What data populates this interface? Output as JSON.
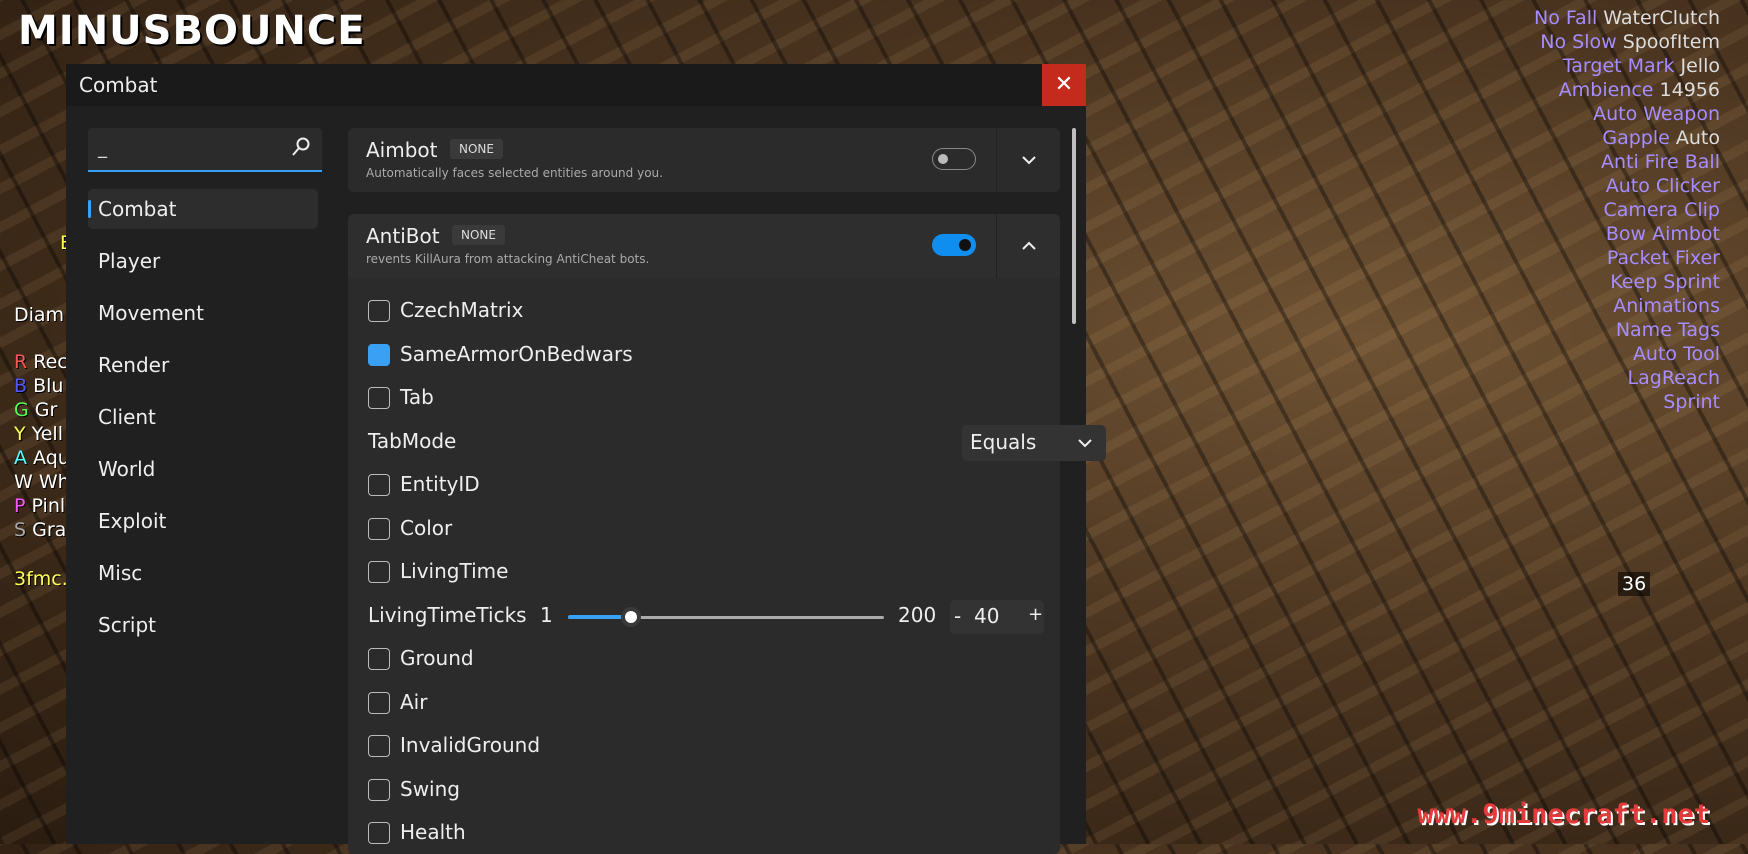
{
  "client": {
    "logo": "MINUSBOUNCE"
  },
  "window": {
    "title": "Combat",
    "close_glyph": "✕"
  },
  "search": {
    "value": "_"
  },
  "nav": [
    "Combat",
    "Player",
    "Movement",
    "Render",
    "Client",
    "World",
    "Exploit",
    "Misc",
    "Script"
  ],
  "modules": [
    {
      "name": "Aimbot",
      "keybind": "NONE",
      "description": "Automatically faces selected entities around you.",
      "enabled": false,
      "expanded": false
    },
    {
      "name": "AntiBot",
      "keybind": "NONE",
      "description": "revents KillAura from attacking AntiCheat bots.",
      "enabled": true,
      "expanded": true
    }
  ],
  "antibot_settings": {
    "czechmatrix": {
      "label": "CzechMatrix",
      "checked": false
    },
    "samearmor": {
      "label": "SameArmorOnBedwars",
      "checked": true
    },
    "tab": {
      "label": "Tab",
      "checked": false
    },
    "tabmode": {
      "label": "TabMode",
      "value": "Equals"
    },
    "entityid": {
      "label": "EntityID",
      "checked": false
    },
    "color": {
      "label": "Color",
      "checked": false
    },
    "livingtime": {
      "label": "LivingTime",
      "checked": false
    },
    "livingtimeticks": {
      "label": "LivingTimeTicks",
      "min": "1",
      "max": "200",
      "value": "40",
      "fraction": 0.2,
      "minus": "-",
      "plus": "+"
    },
    "ground": {
      "label": "Ground",
      "checked": false
    },
    "air": {
      "label": "Air",
      "checked": false
    },
    "invalidground": {
      "label": "InvalidGround",
      "checked": false
    },
    "swing": {
      "label": "Swing",
      "checked": false
    },
    "health": {
      "label": "Health",
      "checked": false
    }
  },
  "arraylist": [
    {
      "name": "No Fall",
      "tag": "WaterClutch"
    },
    {
      "name": "No Slow",
      "tag": "SpoofItem"
    },
    {
      "name": "Target Mark",
      "tag": "Jello"
    },
    {
      "name": "Ambience",
      "tag": "14956"
    },
    {
      "name": "Auto Weapon",
      "tag": ""
    },
    {
      "name": "Gapple",
      "tag": "Auto"
    },
    {
      "name": "Anti Fire Ball",
      "tag": ""
    },
    {
      "name": "Auto Clicker",
      "tag": ""
    },
    {
      "name": "Camera Clip",
      "tag": ""
    },
    {
      "name": "Bow Aimbot",
      "tag": ""
    },
    {
      "name": "Packet Fixer",
      "tag": ""
    },
    {
      "name": "Keep Sprint",
      "tag": ""
    },
    {
      "name": "Animations",
      "tag": ""
    },
    {
      "name": "Name Tags",
      "tag": ""
    },
    {
      "name": "Auto Tool",
      "tag": ""
    },
    {
      "name": "LagReach",
      "tag": ""
    },
    {
      "name": "Sprint",
      "tag": ""
    }
  ],
  "left_hud": {
    "e": "E",
    "diamond": "Diam",
    "teams": [
      {
        "letter": "R",
        "rest": "Rec",
        "color": "#ff5555"
      },
      {
        "letter": "B",
        "rest": "Blu",
        "color": "#5555ff"
      },
      {
        "letter": "G",
        "rest": "Gr",
        "color": "#55ff55"
      },
      {
        "letter": "Y",
        "rest": "Yell",
        "color": "#ffff55"
      },
      {
        "letter": "A",
        "rest": "Aqu",
        "color": "#55ffff"
      },
      {
        "letter": "W",
        "rest": "Wh",
        "color": "#ffffff"
      },
      {
        "letter": "P",
        "rest": "Pinl",
        "color": "#ff55ff"
      },
      {
        "letter": "S",
        "rest": "Gra",
        "color": "#aaaaaa"
      }
    ],
    "server": "3fmc."
  },
  "fps": "36",
  "watermark": "www.9minecraft.net",
  "colors": {
    "accent": "#3aa0f3",
    "close": "#c42b1c",
    "mod_name": "#a58cff"
  }
}
